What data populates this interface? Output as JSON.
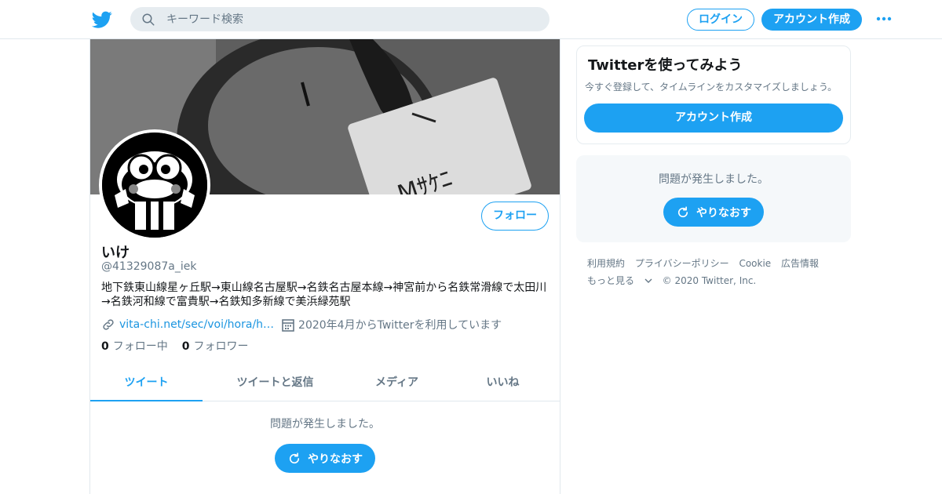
{
  "header": {
    "search_placeholder": "キーワード検索",
    "login_label": "ログイン",
    "signup_label": "アカウント作成"
  },
  "profile": {
    "name": "いけ",
    "handle": "@41329087a_iek",
    "bio": "地下鉄東山線星ヶ丘駅→東山線名古屋駅→名鉄名古屋本線→神宮前から名鉄常滑線で太田川→名鉄河和線で富貴駅→名鉄知多新線で美浜緑苑駅",
    "website": "vita-chi.net/sec/voi/hora/h…",
    "joined": "2020年4月からTwitterを利用しています",
    "following_count": "0",
    "following_label": "フォロー中",
    "followers_count": "0",
    "followers_label": "フォロワー",
    "follow_label": "フォロー"
  },
  "tabs": [
    {
      "label": "ツイート",
      "active": true
    },
    {
      "label": "ツイートと返信",
      "active": false
    },
    {
      "label": "メディア",
      "active": false
    },
    {
      "label": "いいね",
      "active": false
    }
  ],
  "timeline": {
    "error_text": "問題が発生しました。",
    "retry_label": "やりなおす"
  },
  "sidebar": {
    "signup_card": {
      "title": "Twitterを使ってみよう",
      "subtitle": "今すぐ登録して、タイムラインをカスタマイズしましょう。",
      "button_label": "アカウント作成"
    },
    "error_card": {
      "error_text": "問題が発生しました。",
      "retry_label": "やりなおす"
    },
    "footer": {
      "links": [
        "利用規約",
        "プライバシーポリシー",
        "Cookie",
        "広告情報"
      ],
      "more_label": "もっと見る",
      "copyright": "© 2020 Twitter, Inc."
    }
  },
  "colors": {
    "brand": "#1da1f2",
    "muted_text": "#657786",
    "link": "#1b95e0"
  }
}
